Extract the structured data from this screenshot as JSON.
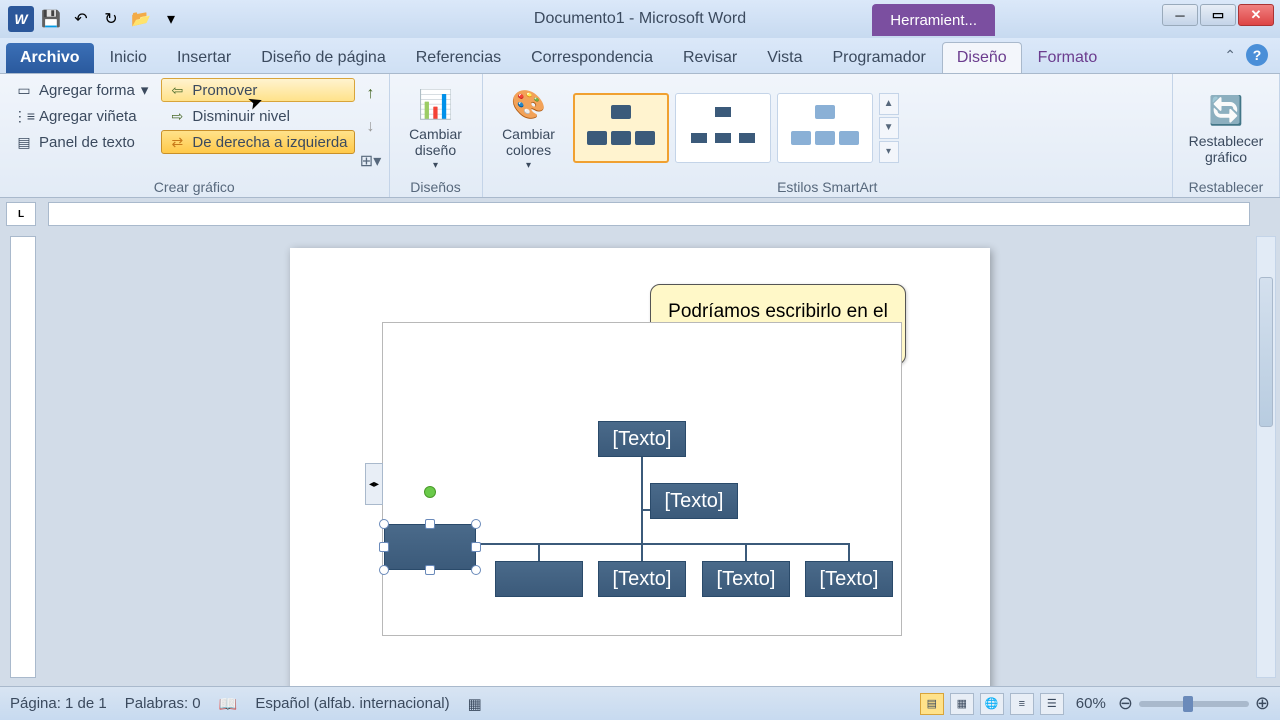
{
  "titlebar": {
    "title": "Documento1 - Microsoft Word",
    "context_tab": "Herramient..."
  },
  "tabs": {
    "file": "Archivo",
    "home": "Inicio",
    "insert": "Insertar",
    "layout": "Diseño de página",
    "references": "Referencias",
    "mailings": "Correspondencia",
    "review": "Revisar",
    "view": "Vista",
    "developer": "Programador",
    "design": "Diseño",
    "format": "Formato"
  },
  "ribbon": {
    "create_graphic": {
      "label": "Crear gráfico",
      "add_shape": "Agregar forma",
      "add_bullet": "Agregar viñeta",
      "text_pane": "Panel de texto",
      "promote": "Promover",
      "demote": "Disminuir nivel",
      "rtl": "De derecha a izquierda"
    },
    "layouts": {
      "label": "Diseños",
      "change_layout": "Cambiar diseño"
    },
    "styles": {
      "label": "Estilos SmartArt",
      "change_colors": "Cambiar colores"
    },
    "reset": {
      "label": "Restablecer",
      "reset_graphic": "Restablecer gráfico"
    }
  },
  "diagram": {
    "placeholder": "[Texto]"
  },
  "callout": {
    "text": "Podríamos escribirlo en el propio diagrama."
  },
  "statusbar": {
    "page": "Página: 1 de 1",
    "words": "Palabras: 0",
    "language": "Español (alfab. internacional)",
    "zoom": "60%"
  }
}
